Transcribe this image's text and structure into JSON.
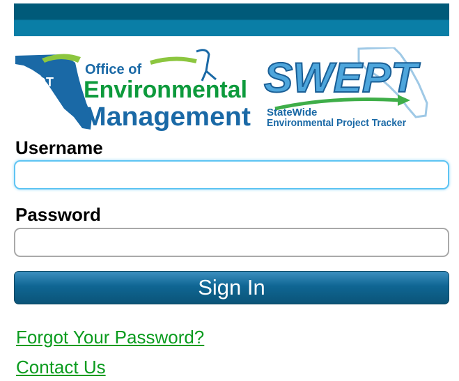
{
  "logos": {
    "fdot": {
      "badge": "FDOT",
      "line1": "Office of",
      "line2": "Environmental",
      "line3": "Management"
    },
    "swept": {
      "title": "SWEPT",
      "line1": "StateWide",
      "line2": "Environmental Project Tracker"
    }
  },
  "form": {
    "username_label": "Username",
    "username_value": "",
    "password_label": "Password",
    "password_value": "",
    "signin_label": "Sign In"
  },
  "links": {
    "forgot": "Forgot Your Password?",
    "contact": "Contact Us"
  },
  "colors": {
    "header_dark": "#005a79",
    "header_light": "#0a7ea6",
    "button": "#0f6693",
    "link": "#0a9b1e",
    "logo_green": "#0d9a3c",
    "logo_blue": "#1a69a6"
  }
}
